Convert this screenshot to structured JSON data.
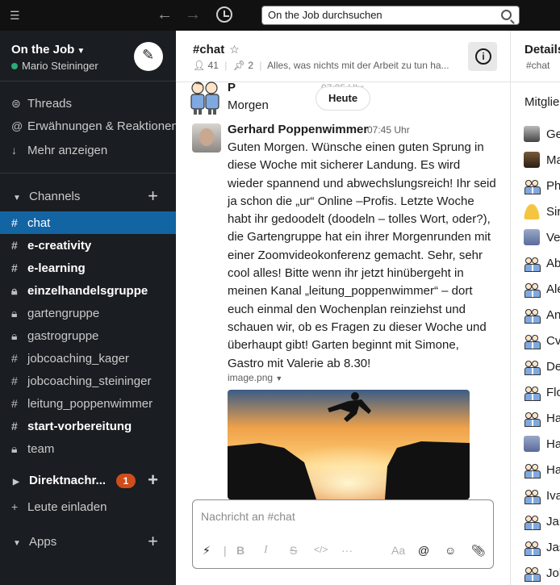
{
  "topbar": {
    "search_text": "On the Job durchsuchen"
  },
  "workspace": {
    "name": "On the Job",
    "user": "Mario Steininger"
  },
  "sidebar": {
    "top_items": [
      {
        "label": "Threads",
        "icon": "threads-icon"
      },
      {
        "label": "Erwähnungen & Reaktionen",
        "icon": "at-icon"
      },
      {
        "label": "Mehr anzeigen",
        "icon": "arrow-down-icon"
      }
    ],
    "channels_label": "Channels",
    "channels": [
      {
        "name": "chat",
        "prefix": "#",
        "state": "active"
      },
      {
        "name": "e-creativity",
        "prefix": "#",
        "state": "unread"
      },
      {
        "name": "e-learning",
        "prefix": "#",
        "state": "unread"
      },
      {
        "name": "einzelhandelsgruppe",
        "prefix": "lock",
        "state": "unread"
      },
      {
        "name": "gartengruppe",
        "prefix": "lock",
        "state": "normal"
      },
      {
        "name": "gastrogruppe",
        "prefix": "lock",
        "state": "normal"
      },
      {
        "name": "jobcoaching_kager",
        "prefix": "#",
        "state": "normal"
      },
      {
        "name": "jobcoaching_steininger",
        "prefix": "#",
        "state": "normal"
      },
      {
        "name": "leitung_poppenwimmer",
        "prefix": "#",
        "state": "normal"
      },
      {
        "name": "start-vorbereitung",
        "prefix": "#",
        "state": "unread"
      },
      {
        "name": "team",
        "prefix": "lock",
        "state": "normal"
      }
    ],
    "direct_label": "Direktnachr...",
    "direct_badge": "1",
    "invite_label": "Leute einladen",
    "apps_label": "Apps"
  },
  "channel": {
    "title": "#chat",
    "members": "41",
    "pins": "2",
    "topic": "Alles, was nichts mit der Arbeit zu tun ha..."
  },
  "messages": {
    "prev_name": "P",
    "prev_time": "07:35 Uhr",
    "prev_text": "Morgen",
    "date_divider": "Heute",
    "author": "Gerhard Poppenwimmer",
    "time": "07:45 Uhr",
    "text": "Guten Morgen. Wünsche einen guten Sprung in diese Woche mit sicherer Landung. Es wird wieder spannend und abwechslungsreich! Ihr seid ja schon die „ur“ Online –Profis. Letzte Woche habt ihr gedoodelt (doodeln – tolles Wort, oder?), die Gartengruppe hat ein ihrer Morgenrunden mit einer Zoomvideokonferenz gemacht. Sehr, sehr cool alles!  Bitte wenn ihr jetzt hinübergeht in meinen Kanal „leitung_poppenwimmer“ – dort euch einmal den Wochenplan reinziehst und schauen wir, ob es Fragen zu dieser Woche und überhaupt gibt! Garten beginnt mit Simone, Gastro mit Valerie ab 8.30!",
    "file_name": "image.png"
  },
  "composer": {
    "placeholder": "Nachricht an #chat"
  },
  "details": {
    "title": "Details",
    "subtitle": "#chat",
    "section": "Mitglieder",
    "members": [
      {
        "name": "Ge",
        "avatar": "photo"
      },
      {
        "name": "Ma",
        "avatar": "photo2"
      },
      {
        "name": "Ph",
        "avatar": "pict"
      },
      {
        "name": "Sir",
        "avatar": "yellow"
      },
      {
        "name": "Ve",
        "avatar": "photo3"
      },
      {
        "name": "Ab",
        "avatar": "pict"
      },
      {
        "name": "Ale",
        "avatar": "pict"
      },
      {
        "name": "An",
        "avatar": "pict"
      },
      {
        "name": "Cv",
        "avatar": "pict"
      },
      {
        "name": "De",
        "avatar": "pict"
      },
      {
        "name": "Flo",
        "avatar": "pict"
      },
      {
        "name": "Ha",
        "avatar": "pict"
      },
      {
        "name": "Ha",
        "avatar": "photo3"
      },
      {
        "name": "Ha",
        "avatar": "pict"
      },
      {
        "name": "Iva",
        "avatar": "pict"
      },
      {
        "name": "Jar",
        "avatar": "pict"
      },
      {
        "name": "Jas",
        "avatar": "pict"
      },
      {
        "name": "Jol",
        "avatar": "pict"
      }
    ]
  }
}
